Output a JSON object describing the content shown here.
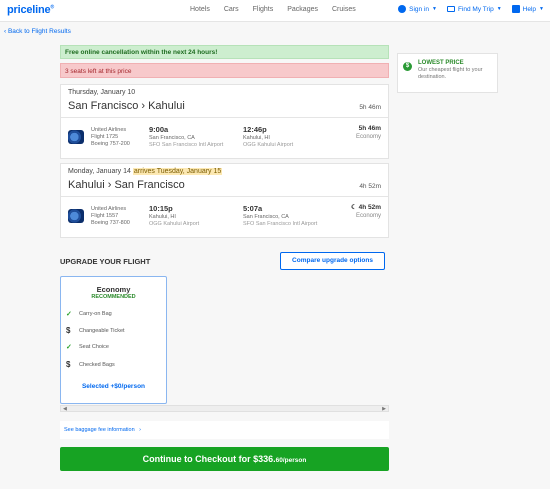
{
  "nav": {
    "logo": "priceline",
    "links": [
      "Hotels",
      "Cars",
      "Flights",
      "Packages",
      "Cruises"
    ],
    "sign_in": "Sign in",
    "find_my_trip": "Find My Trip",
    "help": "Help"
  },
  "back_link": "‹ Back to Flight Results",
  "banners": {
    "cancellation": "Free online cancellation within the next 24 hours!",
    "seats": "3 seats left at this price"
  },
  "legs": [
    {
      "date": "Thursday, January 10",
      "arrives_note": "",
      "route": "San Francisco › Kahului",
      "duration": "5h 46m",
      "airline": "United Airlines",
      "flight": "Flight 1725",
      "aircraft": "Boeing 757-200",
      "dep_time": "9:00a",
      "dep_city": "San Francisco, CA",
      "dep_airport": "SFO San Francisco Intl Airport",
      "arr_time": "12:46p",
      "arr_city": "Kahului, HI",
      "arr_airport": "OGG Kahului Airport",
      "seg_duration": "5h 46m",
      "cabin": "Economy"
    },
    {
      "date": "Monday, January 14",
      "arrives_note": "arrives Tuesday, January 15",
      "route": "Kahului › San Francisco",
      "duration": "4h 52m",
      "airline": "United Airlines",
      "flight": "Flight 1557",
      "aircraft": "Boeing 737-800",
      "dep_time": "10:15p",
      "dep_city": "Kahului, HI",
      "dep_airport": "OGG Kahului Airport",
      "arr_time": "5:07a",
      "arr_city": "San Francisco, CA",
      "arr_airport": "SFO San Francisco Intl Airport",
      "seg_duration": "☾ 4h 52m",
      "cabin": "Economy"
    }
  ],
  "upgrade": {
    "title": "UPGRADE YOUR FLIGHT",
    "compare_button": "Compare upgrade options",
    "fare": {
      "name": "Economy",
      "badge": "RECOMMENDED",
      "features": [
        {
          "icon": "check-icon",
          "label": "Carry-on Bag"
        },
        {
          "icon": "dollar-icon",
          "label": "Changeable Ticket"
        },
        {
          "icon": "check-icon",
          "label": "Seat Choice"
        },
        {
          "icon": "dollar-icon",
          "label": "Checked Bags"
        }
      ],
      "selected": "Selected +$0/person"
    }
  },
  "baggage_link": "See baggage fee information",
  "checkout": {
    "label": "Continue to Checkout for $336.",
    "cents": "60/person"
  },
  "side_panel": {
    "title": "LOWEST PRICE",
    "description": "Our cheapest flight to your destination."
  },
  "colors": {
    "brand_blue": "#0068ef",
    "success_green": "#17a323",
    "banner_green": "#cdeecf",
    "banner_red": "#f7c9cb"
  }
}
